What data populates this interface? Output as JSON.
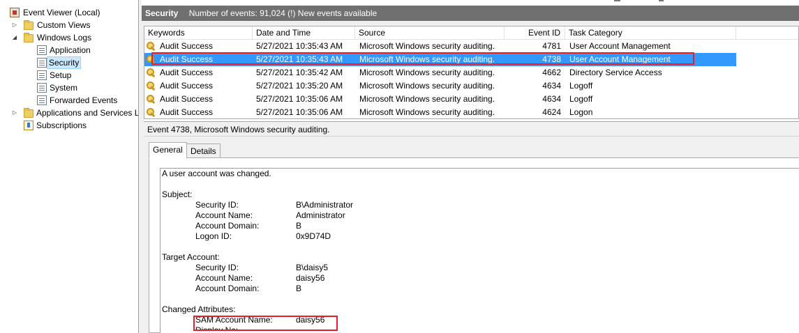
{
  "tree": {
    "root": "Event Viewer (Local)",
    "custom_views": "Custom Views",
    "windows_logs": "Windows Logs",
    "logs": [
      "Application",
      "Security",
      "Setup",
      "System",
      "Forwarded Events"
    ],
    "apps_services": "Applications and Services L",
    "subscriptions": "Subscriptions",
    "selected": "Security"
  },
  "header": {
    "title": "Security",
    "info": "Number of events: 91,024 (!) New events available"
  },
  "grid": {
    "columns": [
      "Keywords",
      "Date and Time",
      "Source",
      "Event ID",
      "Task Category"
    ],
    "rows": [
      {
        "keyword": "Audit Success",
        "datetime": "5/27/2021 10:35:43 AM",
        "source": "Microsoft Windows security auditing.",
        "event_id": "4781",
        "category": "User Account Management"
      },
      {
        "keyword": "Audit Success",
        "datetime": "5/27/2021 10:35:43 AM",
        "source": "Microsoft Windows security auditing.",
        "event_id": "4738",
        "category": "User Account Management"
      },
      {
        "keyword": "Audit Success",
        "datetime": "5/27/2021 10:35:42 AM",
        "source": "Microsoft Windows security auditing.",
        "event_id": "4662",
        "category": "Directory Service Access"
      },
      {
        "keyword": "Audit Success",
        "datetime": "5/27/2021 10:35:20 AM",
        "source": "Microsoft Windows security auditing.",
        "event_id": "4634",
        "category": "Logoff"
      },
      {
        "keyword": "Audit Success",
        "datetime": "5/27/2021 10:35:06 AM",
        "source": "Microsoft Windows security auditing.",
        "event_id": "4634",
        "category": "Logoff"
      },
      {
        "keyword": "Audit Success",
        "datetime": "5/27/2021 10:35:06 AM",
        "source": "Microsoft Windows security auditing.",
        "event_id": "4624",
        "category": "Logon"
      }
    ],
    "selected_row": 1
  },
  "detail": {
    "title": "Event 4738, Microsoft Windows security auditing.",
    "tabs": [
      "General",
      "Details"
    ],
    "active_tab": "General",
    "message": {
      "intro": "A user account was changed.",
      "subject_heading": "Subject:",
      "subject": [
        {
          "label": "Security ID:",
          "value": "B\\Administrator"
        },
        {
          "label": "Account Name:",
          "value": "Administrator"
        },
        {
          "label": "Account Domain:",
          "value": "B"
        },
        {
          "label": "Logon ID:",
          "value": "0x9D74D"
        }
      ],
      "target_heading": "Target Account:",
      "target": [
        {
          "label": "Security ID:",
          "value": "B\\daisy5"
        },
        {
          "label": "Account Name:",
          "value": "daisy56"
        },
        {
          "label": "Account Domain:",
          "value": "B"
        }
      ],
      "changed_heading": "Changed Attributes:",
      "changed": [
        {
          "label": "SAM Account Name:",
          "value": "daisy56"
        }
      ]
    }
  },
  "colors": {
    "header_bg": "#707070",
    "selection": "#3399ff",
    "highlight_box": "#e0212b"
  }
}
